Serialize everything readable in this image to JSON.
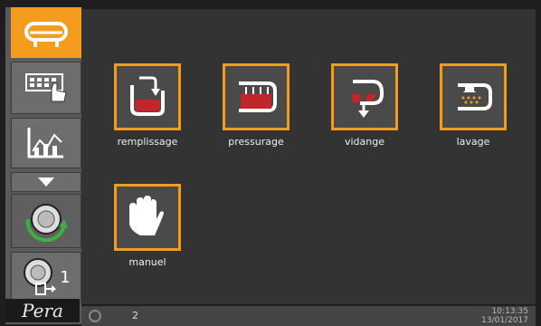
{
  "sidebar": {
    "items": [
      {
        "name": "press-icon"
      },
      {
        "name": "keyboard-hand-icon"
      },
      {
        "name": "chart-icon"
      },
      {
        "name": "dropdown-arrow-icon"
      },
      {
        "name": "dial-cycle-icon"
      },
      {
        "name": "dial-export-icon",
        "label": "1"
      }
    ],
    "logo": "Pera"
  },
  "tiles": [
    {
      "label": "remplissage",
      "icon": "fill-icon"
    },
    {
      "label": "pressurage",
      "icon": "press-icon"
    },
    {
      "label": "vidange",
      "icon": "drain-icon"
    },
    {
      "label": "lavage",
      "icon": "wash-icon"
    },
    {
      "label": "manuel",
      "icon": "hand-icon"
    }
  ],
  "status": {
    "text": "2",
    "time": "10:13:35",
    "date": "13/01/2017"
  },
  "colors": {
    "accent": "#f39c1e",
    "red": "#c0272d",
    "background": "#333333"
  }
}
